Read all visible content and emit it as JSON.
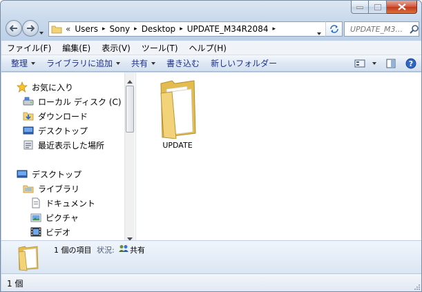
{
  "window": {
    "caption_buttons": {
      "minimize": "–",
      "maximize": "□",
      "close": "✕"
    }
  },
  "address": {
    "chevron": "«",
    "crumbs": [
      "Users",
      "Sony",
      "Desktop",
      "UPDATE_M34R2084"
    ]
  },
  "search": {
    "placeholder": "UPDATE_M3..."
  },
  "menu": [
    "ファイル(F)",
    "編集(E)",
    "表示(V)",
    "ツール(T)",
    "ヘルプ(H)"
  ],
  "toolbar": {
    "organize": "整理",
    "add_to_library": "ライブラリに追加",
    "share": "共有",
    "burn": "書き込む",
    "new_folder": "新しいフォルダー"
  },
  "nav": {
    "favorites_header": "お気に入り",
    "favorites": [
      "ローカル ディスク (C)",
      "ダウンロード",
      "デスクトップ",
      "最近表示した場所"
    ],
    "desktop_header": "デスクトップ",
    "libraries_header": "ライブラリ",
    "libraries": [
      "ドキュメント",
      "ピクチャ",
      "ビデオ"
    ]
  },
  "content": {
    "items": [
      {
        "name": "UPDATE",
        "type": "folder"
      }
    ]
  },
  "details": {
    "count_text": "1 個の項目",
    "state_label": "状況:",
    "state_value": "共有"
  },
  "status": {
    "text": "1 個"
  },
  "colors": {
    "link_blue": "#1e3287",
    "folder_yellow": "#f3d37a",
    "title_gradient_top": "#dce6f2"
  }
}
